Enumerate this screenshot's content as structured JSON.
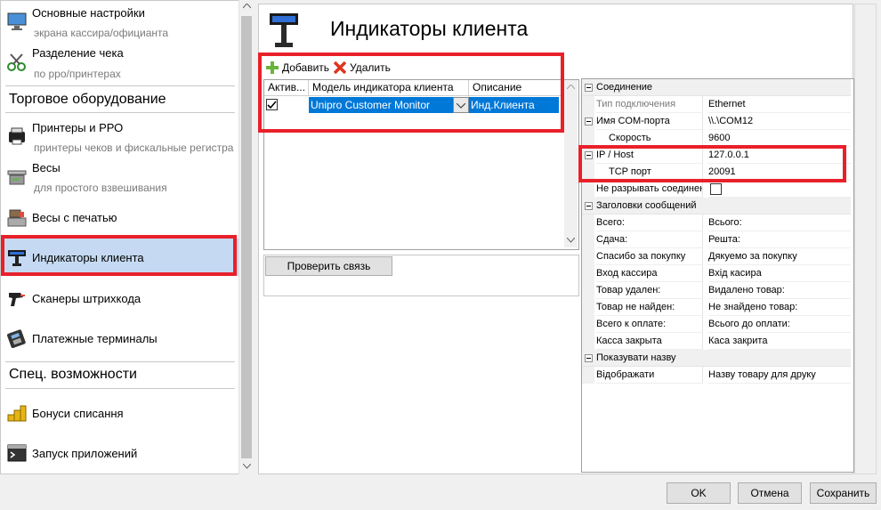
{
  "nav": {
    "items": [
      {
        "title": "Основные настройки",
        "sub": "экрана кассира/официанта",
        "icon": "monitor-icon"
      },
      {
        "title": "Разделение чека",
        "sub": "по рро/принтерах",
        "icon": "scissors-icon"
      }
    ],
    "section1": "Торговое оборудование",
    "equipment": [
      {
        "title": "Принтеры и РРО",
        "sub": "принтеры чеков и фискальные регистра",
        "icon": "printer-icon"
      },
      {
        "title": "Весы",
        "sub": "для простого взвешивания",
        "icon": "scale-icon"
      },
      {
        "title": "Весы с печатью",
        "sub": "",
        "icon": "label-scale-icon"
      },
      {
        "title": "Индикаторы клиента",
        "sub": "",
        "icon": "customer-display-icon",
        "selected": true
      },
      {
        "title": "Сканеры штрихкода",
        "sub": "",
        "icon": "barcode-scanner-icon"
      },
      {
        "title": "Платежные терминалы",
        "sub": "",
        "icon": "payment-terminal-icon"
      }
    ],
    "section2": "Спец. возможности",
    "special": [
      {
        "title": "Бонуси списання",
        "sub": "",
        "icon": "coins-icon"
      },
      {
        "title": "Запуск приложений",
        "sub": "",
        "icon": "terminal-icon"
      }
    ]
  },
  "page": {
    "title": "Индикаторы клиента"
  },
  "toolbar": {
    "add_label": "Добавить",
    "delete_label": "Удалить"
  },
  "table": {
    "headers": [
      "Актив...",
      "Модель индикатора клиента",
      "Описание"
    ],
    "rows": [
      {
        "active": true,
        "model": "Unipro Customer Monitor",
        "description": "Инд.Клиента"
      }
    ]
  },
  "check_button": "Проверить связь",
  "props": {
    "connection_cat": "Соединение",
    "conn_type_label": "Тип подключения",
    "conn_type_value": "Ethernet",
    "com_label": "Имя COM-порта",
    "com_value": "\\\\.\\COM12",
    "speed_label": "Скорость",
    "speed_value": "9600",
    "ip_label": "IP / Host",
    "ip_value": "127.0.0.1",
    "tcp_label": "TCP порт",
    "tcp_value": "20091",
    "keep_label": "Не разрывать соединен",
    "headers_cat": "Заголовки сообщений",
    "messages": [
      {
        "k": "Всего:",
        "v": "Всього:"
      },
      {
        "k": "Сдача:",
        "v": "Решта:"
      },
      {
        "k": "Спасибо за покупку",
        "v": "Дякуемо за покупку"
      },
      {
        "k": "Вход кассира",
        "v": "Вхід касира"
      },
      {
        "k": "Товар удален:",
        "v": "Видалено товар:"
      },
      {
        "k": "Товар не найден:",
        "v": "Не знайдено товар:"
      },
      {
        "k": "Всего к оплате:",
        "v": "Всього до оплати:"
      },
      {
        "k": "Касса закрыта",
        "v": "Каса закрита"
      }
    ],
    "show_cat": "Показувати назву",
    "display_label": "Відображати",
    "display_value": "Назву товару для друку"
  },
  "buttons": {
    "ok": "OK",
    "cancel": "Отмена",
    "save": "Сохранить"
  },
  "colors": {
    "selection": "#0078d7",
    "highlight": "#e8202a",
    "nav_selected": "#c5daf2"
  }
}
